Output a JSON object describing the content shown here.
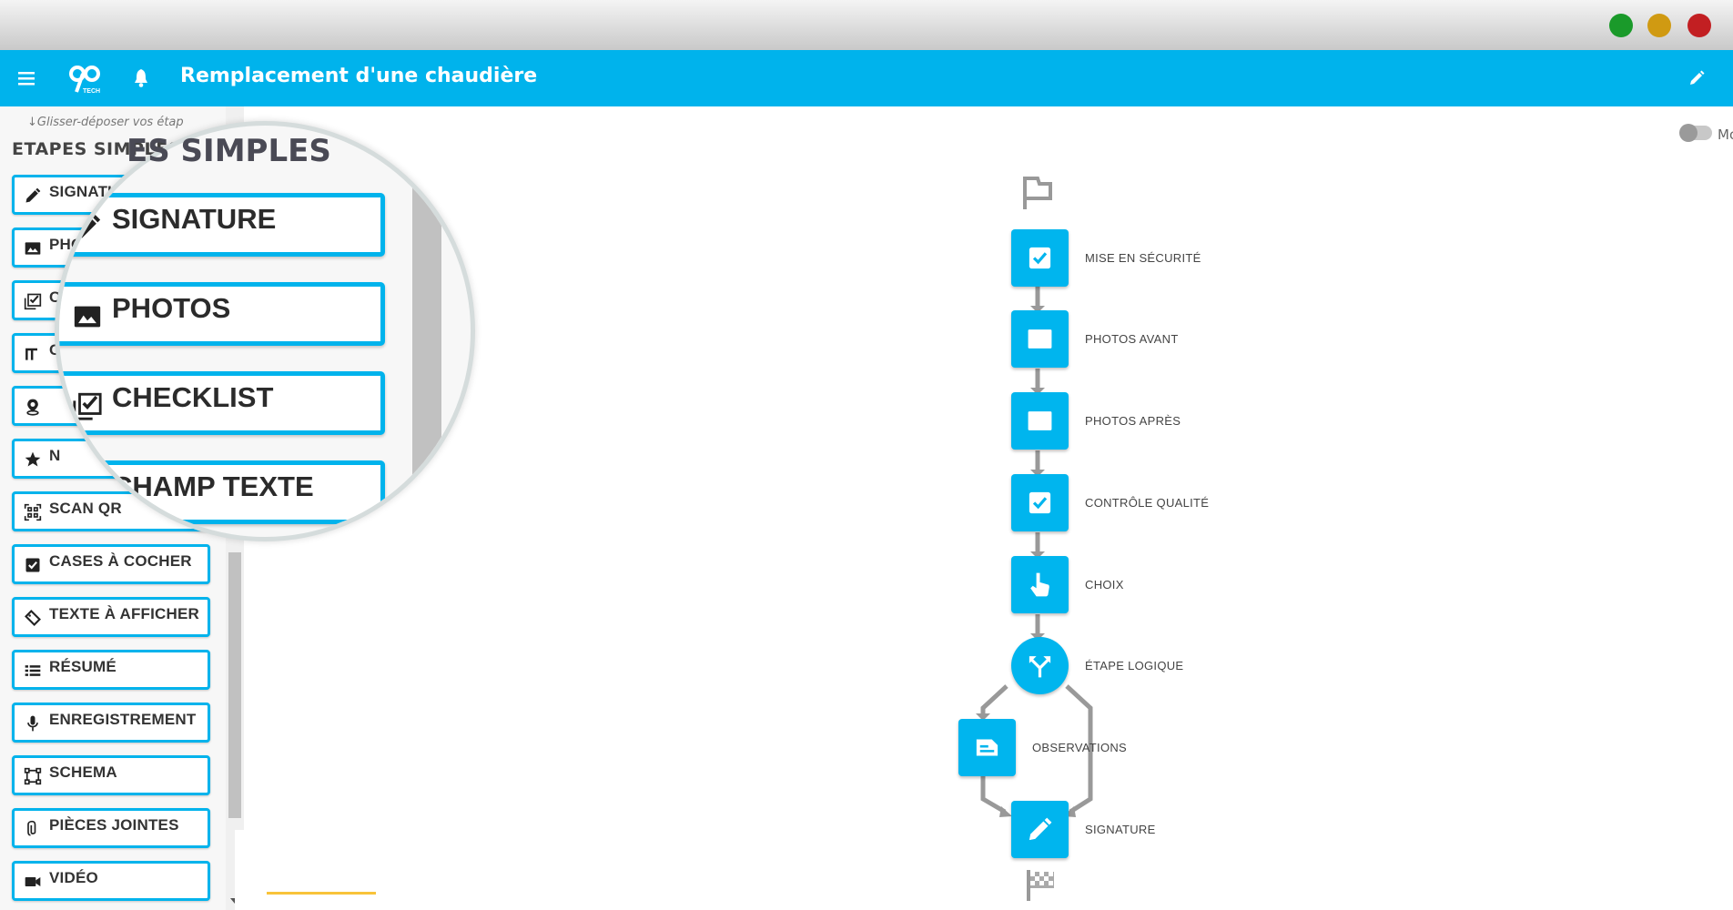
{
  "window": {
    "controls": [
      {
        "name": "maximize",
        "color": "#1a9a2a"
      },
      {
        "name": "minimize",
        "color": "#d09a12"
      },
      {
        "name": "close",
        "color": "#c21f22"
      }
    ]
  },
  "header": {
    "title": "Remplacement d'une chaudière",
    "logo": "90 Tech",
    "accent": "#00b3ec"
  },
  "sidebar": {
    "hint": "↓Glisser-déposer vos étap",
    "title": "ETAPES SIMPLES",
    "items": [
      {
        "label": "SIGNATURE",
        "icon": "pencil-icon"
      },
      {
        "label": "PHOTOS",
        "icon": "image-icon"
      },
      {
        "label": "CHECKLIST",
        "icon": "checklist-icon"
      },
      {
        "label": "CHAMP TEXTE",
        "icon": "text-field-icon"
      },
      {
        "label": "",
        "icon": "location-pin-icon"
      },
      {
        "label": "N",
        "icon": "star-icon"
      },
      {
        "label": "SCAN QR",
        "icon": "qr-code-icon"
      },
      {
        "label": "CASES À COCHER",
        "icon": "checkbox-icon"
      },
      {
        "label": "TEXTE À AFFICHER",
        "icon": "tag-icon"
      },
      {
        "label": "RÉSUMÉ",
        "icon": "list-icon"
      },
      {
        "label": "ENREGISTREMENT",
        "icon": "microphone-icon"
      },
      {
        "label": "SCHEMA",
        "icon": "vector-square-icon"
      },
      {
        "label": "PIÈCES JOINTES",
        "icon": "paperclip-icon"
      },
      {
        "label": "VIDÉO",
        "icon": "video-camera-icon"
      }
    ]
  },
  "magnifier": {
    "title": "ETAPES SIMPLES",
    "items": [
      "SIGNATURE",
      "PHOTOS",
      "CHECKLIST",
      "CHAMP TEXTE"
    ]
  },
  "toggle": {
    "label": "Mo",
    "on": false
  },
  "flow": {
    "steps": [
      {
        "label": "MISE EN SÉCURITÉ",
        "icon": "checkbox-icon"
      },
      {
        "label": "PHOTOS AVANT",
        "icon": "image-icon"
      },
      {
        "label": "PHOTOS APRÈS",
        "icon": "image-icon"
      },
      {
        "label": "CONTRÔLE QUALITÉ",
        "icon": "checkbox-icon"
      },
      {
        "label": "CHOIX",
        "icon": "hand-pointer-icon"
      },
      {
        "label": "ÉTAPE LOGIQUE",
        "icon": "split-arrows-icon"
      },
      {
        "label": "OBSERVATIONS",
        "icon": "document-icon"
      },
      {
        "label": "SIGNATURE",
        "icon": "pencil-icon"
      }
    ]
  }
}
